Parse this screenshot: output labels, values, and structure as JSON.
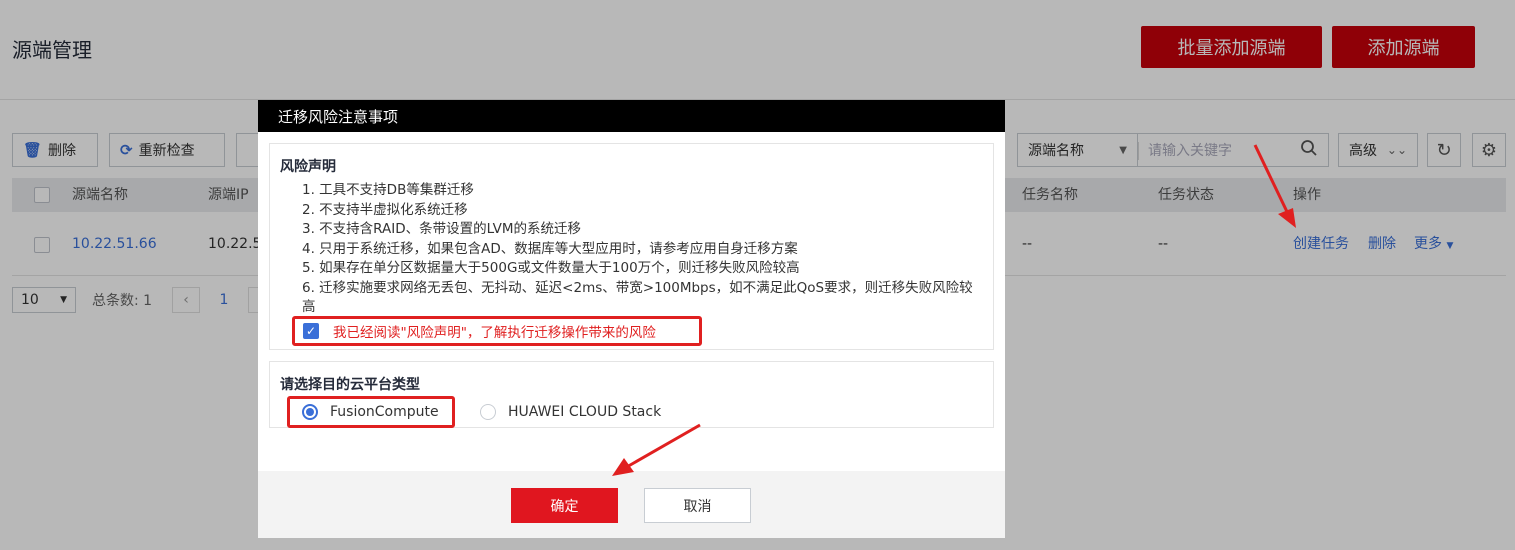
{
  "page": {
    "title": "源端管理",
    "batch_add_button": "批量添加源端",
    "add_button": "添加源端"
  },
  "toolbar": {
    "delete_label": "删除",
    "recheck_label": "重新检查",
    "filter_field": "源端名称",
    "search_placeholder": "请输入关键字",
    "advanced_label": "高级"
  },
  "table": {
    "columns": [
      "源端名称",
      "源端IP",
      "任务名称",
      "任务状态",
      "操作"
    ],
    "rows": [
      {
        "name": "10.22.51.66",
        "ip": "10.22.5",
        "task_name": "--",
        "task_status": "--",
        "actions": [
          "创建任务",
          "删除",
          "更多"
        ]
      }
    ]
  },
  "pagination": {
    "page_size": "10",
    "total_label": "总条数: 1",
    "current_page": "1"
  },
  "modal": {
    "title": "迁移风险注意事项",
    "risk_title": "风险声明",
    "risk_items": [
      "1. 工具不支持DB等集群迁移",
      "2. 不支持半虚拟化系统迁移",
      "3. 不支持含RAID、条带设置的LVM的系统迁移",
      "4. 只用于系统迁移，如果包含AD、数据库等大型应用时，请参考应用自身迁移方案",
      "5. 如果存在单分区数据量大于500G或文件数量大于100万个，则迁移失败风险较高",
      "6. 迁移实施要求网络无丢包、无抖动、延迟<2ms、带宽>100Mbps，如不满足此QoS要求，则迁移失败风险较高"
    ],
    "ack_text": "我已经阅读\"风险声明\"，了解执行迁移操作带来的风险",
    "ack_checked": true,
    "cloud_title": "请选择目的云平台类型",
    "cloud_options": [
      "FusionCompute",
      "HUAWEI CLOUD Stack"
    ],
    "cloud_selected": "FusionCompute",
    "ok_label": "确定",
    "cancel_label": "取消"
  },
  "colors": {
    "brand_red": "#c7000b",
    "link_blue": "#3a6fd8",
    "annotation_red": "#e02020"
  }
}
